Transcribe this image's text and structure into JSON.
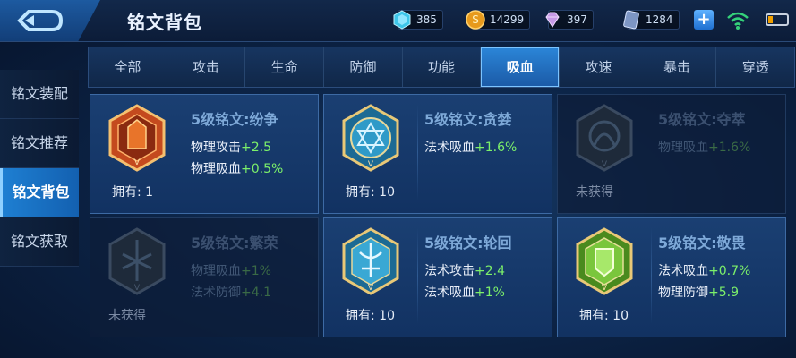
{
  "header": {
    "title": "铭文背包",
    "resources": [
      {
        "icon": "crystal-icon",
        "value": "385"
      },
      {
        "icon": "gold-coin-icon",
        "value": "14299"
      },
      {
        "icon": "diamond-icon",
        "value": "397"
      },
      {
        "icon": "ticket-icon",
        "value": "1284"
      }
    ],
    "plus_label": "+"
  },
  "sidebar": {
    "items": [
      {
        "label": "铭文装配",
        "active": false
      },
      {
        "label": "铭文推荐",
        "active": false
      },
      {
        "label": "铭文背包",
        "active": true
      },
      {
        "label": "铭文获取",
        "active": false
      }
    ]
  },
  "tabs": [
    {
      "label": "全部",
      "active": false
    },
    {
      "label": "攻击",
      "active": false
    },
    {
      "label": "生命",
      "active": false
    },
    {
      "label": "防御",
      "active": false
    },
    {
      "label": "功能",
      "active": false
    },
    {
      "label": "吸血",
      "active": true
    },
    {
      "label": "攻速",
      "active": false
    },
    {
      "label": "暴击",
      "active": false
    },
    {
      "label": "穿透",
      "active": false
    }
  ],
  "cards": [
    {
      "title": "5级铭文:纷争",
      "color": "red",
      "attrs": [
        {
          "name": "物理攻击",
          "value": "+2.5"
        },
        {
          "name": "物理吸血",
          "value": "+0.5%"
        }
      ],
      "owned": "拥有: 1",
      "locked": false
    },
    {
      "title": "5级铭文:贪婪",
      "color": "blue",
      "attrs": [
        {
          "name": "法术吸血",
          "value": "+1.6%"
        }
      ],
      "owned": "拥有: 10",
      "locked": false
    },
    {
      "title": "5级铭文:夺萃",
      "color": "gray",
      "attrs": [
        {
          "name": "物理吸血",
          "value": "+1.6%"
        }
      ],
      "owned": "未获得",
      "locked": true
    },
    {
      "title": "5级铭文:繁荣",
      "color": "gray",
      "attrs": [
        {
          "name": "物理吸血",
          "value": "+1%"
        },
        {
          "name": "法术防御",
          "value": "+4.1"
        }
      ],
      "owned": "未获得",
      "locked": true
    },
    {
      "title": "5级铭文:轮回",
      "color": "blue",
      "attrs": [
        {
          "name": "法术攻击",
          "value": "+2.4"
        },
        {
          "name": "法术吸血",
          "value": "+1%"
        }
      ],
      "owned": "拥有: 10",
      "locked": false
    },
    {
      "title": "5级铭文:敬畏",
      "color": "green",
      "attrs": [
        {
          "name": "法术吸血",
          "value": "+0.7%"
        },
        {
          "name": "物理防御",
          "value": "+5.9"
        }
      ],
      "owned": "拥有: 10",
      "locked": false
    }
  ],
  "colors": {
    "accent": "#1e7fd2",
    "positive": "#7cf06a",
    "red": "#d2542a",
    "blue": "#3fa7d8",
    "green": "#6cc43a",
    "gray": "#4a5a70"
  }
}
